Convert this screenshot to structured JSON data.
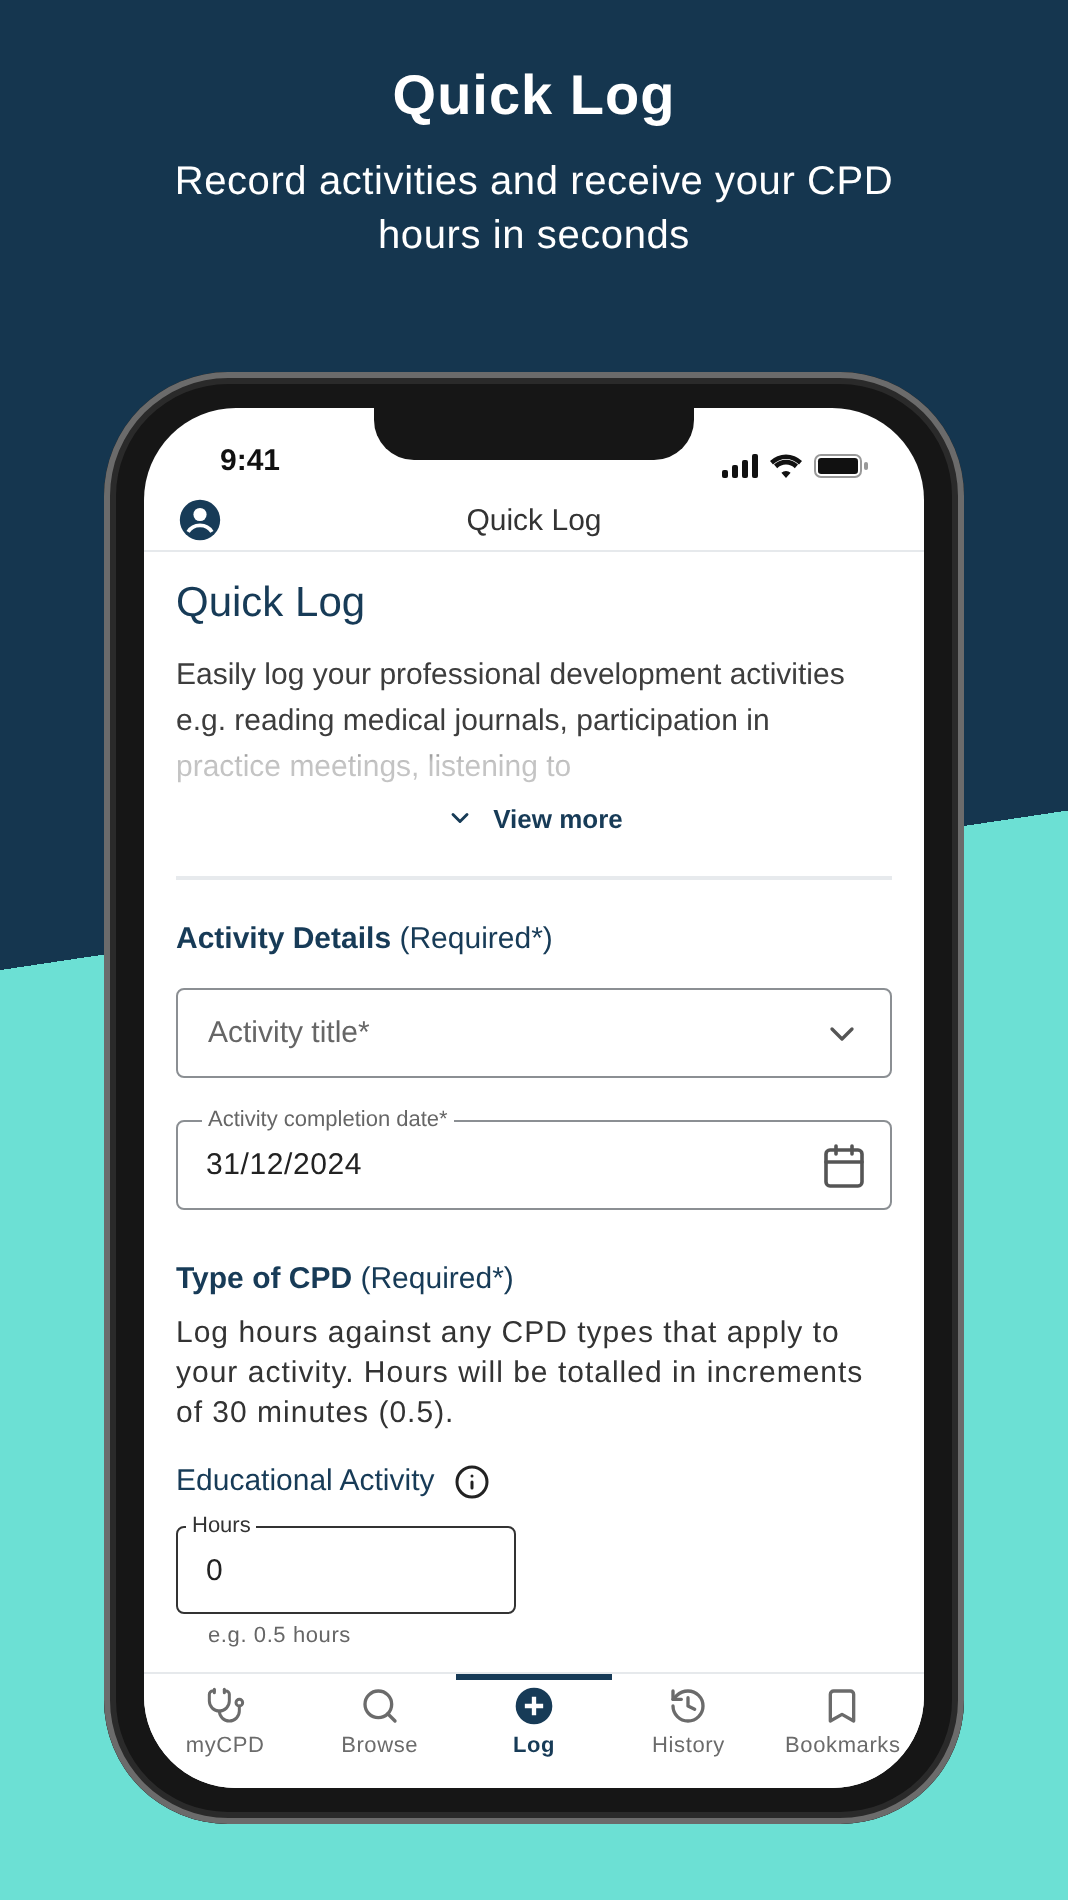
{
  "hero": {
    "title": "Quick Log",
    "subtitle": "Record activities and receive your CPD hours in seconds"
  },
  "status_bar": {
    "time": "9:41"
  },
  "app_bar": {
    "title": "Quick Log"
  },
  "intro": {
    "heading": "Quick Log",
    "description": "Easily log your professional development activities e.g. reading medical journals, participation in practice meetings, listening to",
    "view_more": "View more"
  },
  "activity_details": {
    "heading": "**Activity Details** (Required*)",
    "title_field": {
      "placeholder": "Activity title*"
    },
    "date_field": {
      "label": "Activity completion date*",
      "value": "31/12/2024"
    }
  },
  "cpd_type": {
    "heading": "**Type of CPD** (Required*)",
    "text": "Log hours against any CPD types that apply to your activity. Hours will be totalled in increments of 30 minutes (0.5).",
    "categories": [
      {
        "name": "Educational Activity",
        "field_label": "Hours",
        "value": "0",
        "hint": "e.g. 0.5 hours"
      }
    ]
  },
  "bottom_nav": [
    {
      "label": "myCPD",
      "selected": false
    },
    {
      "label": "Browse",
      "selected": false
    },
    {
      "label": "Log",
      "selected": true
    },
    {
      "label": "History",
      "selected": false
    },
    {
      "label": "Bookmarks",
      "selected": false
    }
  ]
}
